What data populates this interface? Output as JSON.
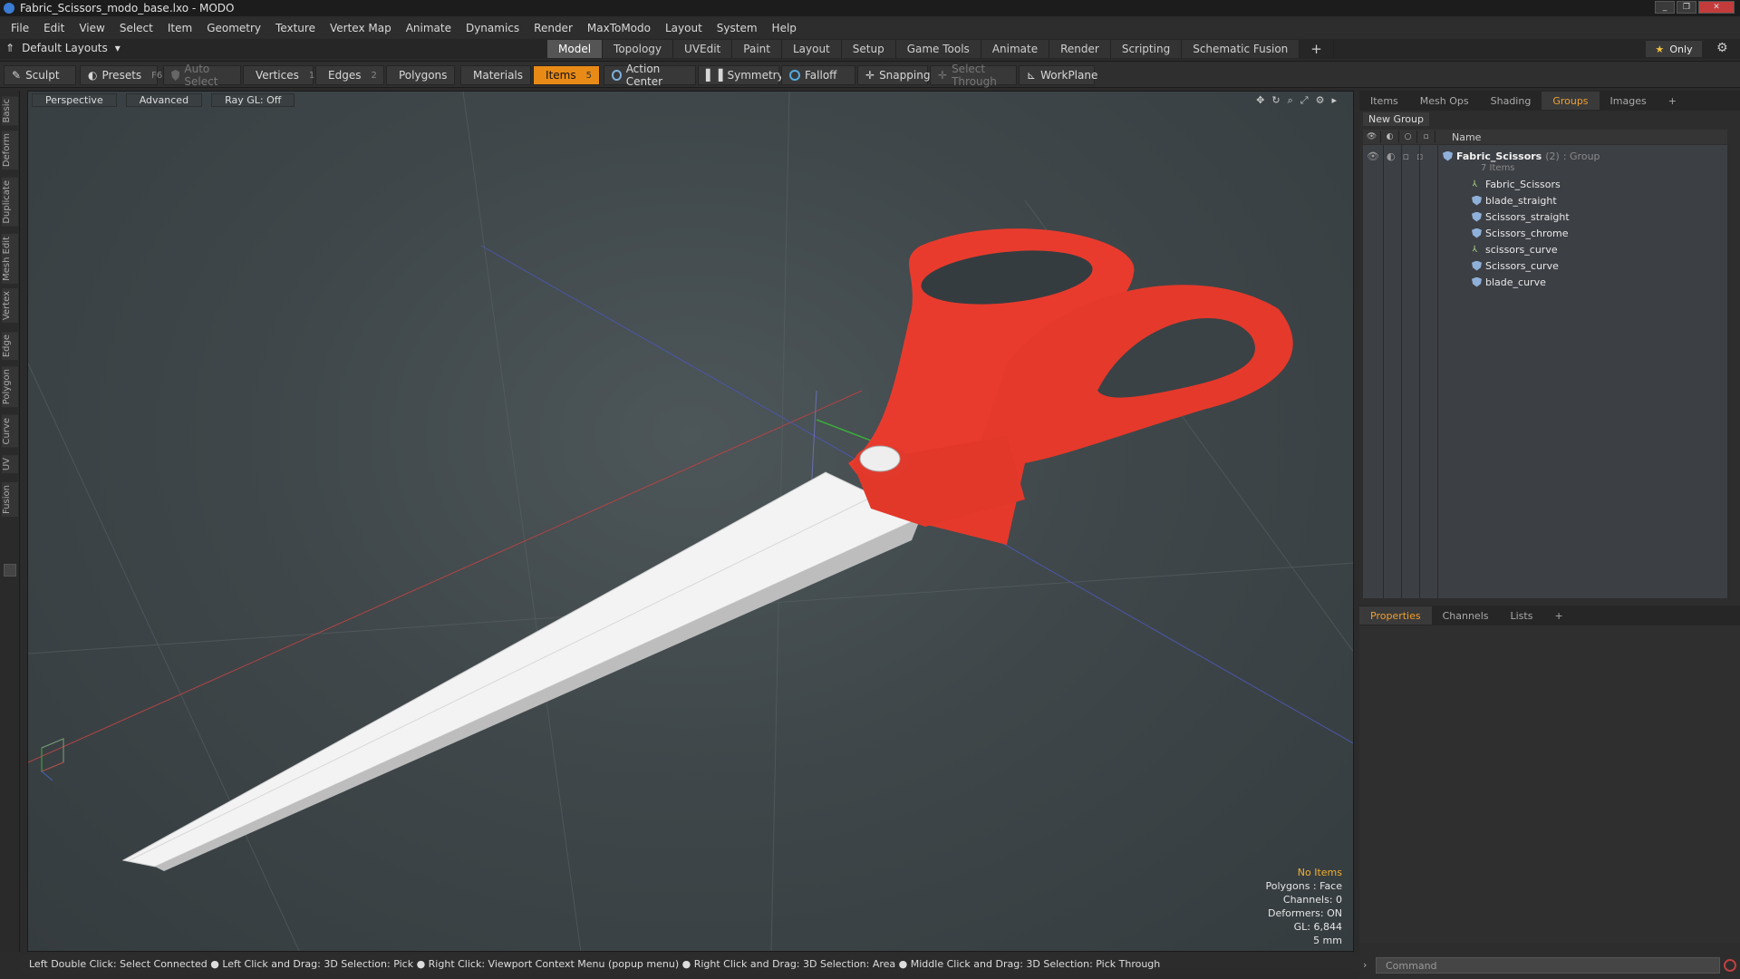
{
  "window": {
    "title": "Fabric_Scissors_modo_base.lxo - MODO"
  },
  "menu": [
    "File",
    "Edit",
    "View",
    "Select",
    "Item",
    "Geometry",
    "Texture",
    "Vertex Map",
    "Animate",
    "Dynamics",
    "Render",
    "MaxToModo",
    "Layout",
    "System",
    "Help"
  ],
  "layouts_label": "Default Layouts",
  "mode_tabs": [
    {
      "label": "Model",
      "active": true
    },
    {
      "label": "Topology"
    },
    {
      "label": "UVEdit"
    },
    {
      "label": "Paint"
    },
    {
      "label": "Layout"
    },
    {
      "label": "Setup"
    },
    {
      "label": "Game Tools"
    },
    {
      "label": "Animate"
    },
    {
      "label": "Render"
    },
    {
      "label": "Scripting"
    },
    {
      "label": "Schematic Fusion"
    }
  ],
  "add_tab": "+",
  "only_label": "Only",
  "toolbar": {
    "sculpt": "Sculpt",
    "presets": "Presets",
    "presets_key": "F6",
    "auto_select": "Auto Select",
    "vertices": "Vertices",
    "vertices_count": "1",
    "edges": "Edges",
    "edges_count": "2",
    "polygons": "Polygons",
    "materials": "Materials",
    "items": "Items",
    "items_count": "5",
    "action_center": "Action Center",
    "symmetry": "Symmetry",
    "falloff": "Falloff",
    "snapping": "Snapping",
    "select_through": "Select Through",
    "workplane": "WorkPlane"
  },
  "left_tabs": [
    "Basic",
    "Deform",
    "Duplicate",
    "Mesh Edit",
    "Vertex",
    "Edge",
    "Polygon",
    "Curve",
    "UV",
    "Fusion"
  ],
  "viewport": {
    "view": "Perspective",
    "shading": "Advanced",
    "raygl": "Ray GL: Off",
    "info": {
      "selection": "No Items",
      "polygons": "Polygons : Face",
      "channels": "Channels: 0",
      "deformers": "Deformers: ON",
      "gl": "GL: 6,844",
      "scale": "5 mm"
    }
  },
  "status": "Left Double Click: Select Connected ● Left Click and Drag: 3D Selection: Pick ● Right Click: Viewport Context Menu (popup menu) ● Right Click and Drag: 3D Selection: Area ● Middle Click and Drag: 3D Selection: Pick Through",
  "panel": {
    "tabs": [
      {
        "label": "Items"
      },
      {
        "label": "Mesh Ops"
      },
      {
        "label": "Shading"
      },
      {
        "label": "Groups",
        "active": true
      },
      {
        "label": "Images"
      }
    ],
    "new_group": "New Group",
    "name_header": "Name",
    "group": {
      "name": "Fabric_Scissors",
      "count": "(2)",
      "type": ": Group",
      "sub": "7 Items"
    },
    "items": [
      {
        "name": "Fabric_Scissors",
        "icon": "locator-icon"
      },
      {
        "name": "blade_straight",
        "icon": "mesh-icon"
      },
      {
        "name": "Scissors_straight",
        "icon": "mesh-icon"
      },
      {
        "name": "Scissors_chrome",
        "icon": "mesh-icon"
      },
      {
        "name": "scissors_curve",
        "icon": "locator-icon"
      },
      {
        "name": "Scissors_curve",
        "icon": "mesh-icon"
      },
      {
        "name": "blade_curve",
        "icon": "mesh-icon"
      }
    ],
    "lower_tabs": [
      {
        "label": "Properties",
        "active": true
      },
      {
        "label": "Channels"
      },
      {
        "label": "Lists"
      }
    ],
    "command_placeholder": "Command"
  },
  "colors": {
    "accent": "#e88a16",
    "scissors_handle": "#e8392c",
    "blade": "#f2f2f2"
  }
}
